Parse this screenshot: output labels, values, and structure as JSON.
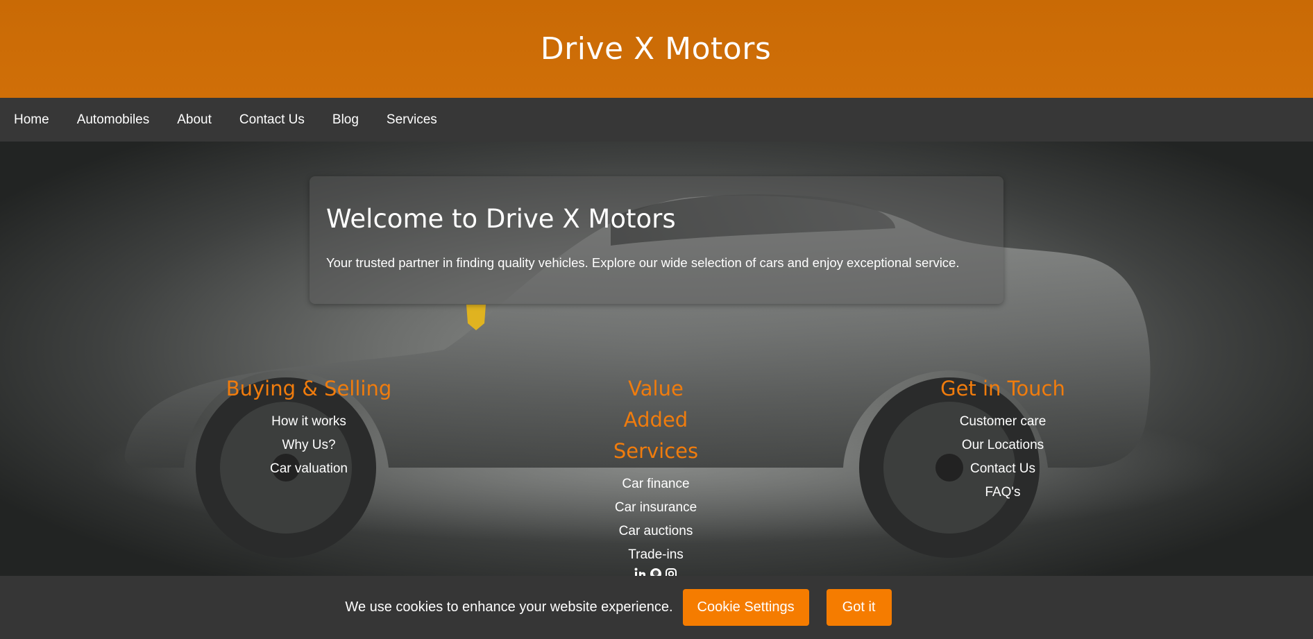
{
  "header": {
    "title": "Drive X Motors"
  },
  "nav": {
    "items": [
      "Home",
      "Automobiles",
      "About",
      "Contact Us",
      "Blog",
      "Services"
    ]
  },
  "welcome": {
    "title": "Welcome to Drive X Motors",
    "text": "Your trusted partner in finding quality vehicles. Explore our wide selection of cars and enjoy exceptional service."
  },
  "footer": {
    "buying": {
      "heading": "Buying & Selling",
      "links": [
        "How it works",
        "Why Us?",
        "Car valuation"
      ]
    },
    "value": {
      "heading": "Value Added Services",
      "links": [
        "Car finance",
        "Car insurance",
        "Car auctions",
        "Trade-ins"
      ]
    },
    "touch": {
      "heading": "Get in Touch",
      "links": [
        "Customer care",
        "Our Locations",
        "Contact Us",
        "FAQ's"
      ]
    },
    "social": [
      "linkedin-icon",
      "github-icon",
      "instagram-icon"
    ]
  },
  "cookie": {
    "text": "We use cookies to enhance your website experience.",
    "settings_label": "Cookie Settings",
    "accept_label": "Got it"
  },
  "colors": {
    "header_bg": "#cc6c06",
    "nav_bg": "#373737",
    "accent": "#f07c0d",
    "button": "#f57c00",
    "cookie_bg": "#363636"
  }
}
